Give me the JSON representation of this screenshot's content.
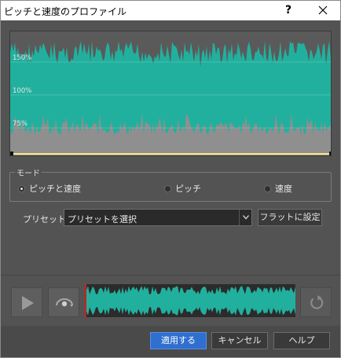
{
  "window": {
    "title": "ピッチと速度のプロファイル",
    "help_label": "?",
    "close_icon": "close-icon"
  },
  "graph": {
    "labels": {
      "p150": "150%",
      "p100": "100%",
      "p75": "75%"
    },
    "colors": {
      "wave": "#22b09e",
      "wave_top": "#27a897",
      "gray": "#8f8f8f",
      "line": "#ffe680"
    }
  },
  "mode": {
    "legend": "モード",
    "options": [
      {
        "label": "ピッチと速度",
        "selected": true
      },
      {
        "label": "ピッチ",
        "selected": false
      },
      {
        "label": "速度",
        "selected": false
      }
    ]
  },
  "preset": {
    "label": "プリセット:",
    "value": "プリセットを選択",
    "flat_button": "フラットに設定"
  },
  "playback": {
    "play_icon": "play-icon",
    "loop_icon": "loop-play-icon",
    "reset_icon": "reset-icon"
  },
  "footer": {
    "apply": "適用する",
    "cancel": "キャンセル",
    "help": "ヘルプ"
  }
}
